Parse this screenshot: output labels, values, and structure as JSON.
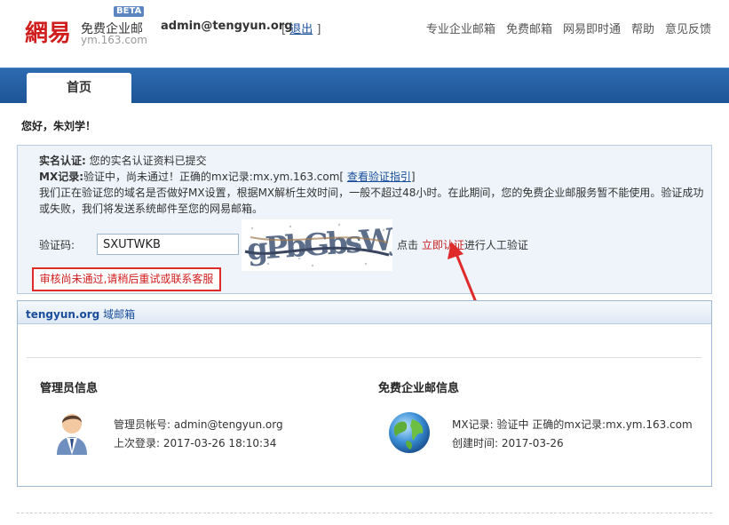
{
  "header": {
    "logo_mark": "網易",
    "logo_product": "免费企业邮",
    "logo_badge": "BETA",
    "logo_domain": "ym.163.com",
    "user_email": "admin@tengyun.org",
    "logout_label": "退出",
    "nav": [
      "专业企业邮箱",
      "免费邮箱",
      "网易即时通",
      "帮助",
      "意见反馈"
    ]
  },
  "tabs": {
    "home": "首页"
  },
  "greeting": "您好，朱刘学！",
  "verify": {
    "realname_label": "实名认证:",
    "realname_text": "您的实名认证资料已提交",
    "mx_label": "MX记录:",
    "mx_text": "验证中，尚未通过！正确的mx记录:mx.ym.163.com[",
    "mx_link": "查看验证指引",
    "mx_close": "]",
    "notice": "我们正在验证您的域名是否做好MX设置，根据MX解析生效时间，一般不超过48小时。在此期间，您的免费企业邮服务暂不能使用。验证成功或失败，我们将发送系统邮件至您的网易邮箱。",
    "captcha_label": "验证码:",
    "captcha_value": "SXUTWKB",
    "captcha_image_text": "gPbGbsWJ",
    "hint_prefix": "点击",
    "hint_link": "立即认证",
    "hint_suffix": "进行人工验证",
    "error": "审核尚未通过,请稍后重试或联系客服"
  },
  "domain_box": {
    "domain": "tengyun.org",
    "title_suffix": "域邮箱",
    "admin_title": "管理员信息",
    "admin_account_label": "管理员帐号:",
    "admin_account": "admin@tengyun.org",
    "last_login_label": "上次登录:",
    "last_login": "2017-03-26 18:10:34",
    "free_title": "免费企业邮信息",
    "mx_label": "MX记录:",
    "mx_status": "验证中 正确的mx记录:mx.ym.163.com",
    "created_label": "创建时间:",
    "created": "2017-03-26"
  },
  "colors": {
    "brand_red": "#d01e1e",
    "header_blue": "#1d5596",
    "link_blue": "#1a4e9c",
    "panel_bg": "#eef4fa"
  },
  "icons": [
    "netease-logo",
    "captcha-image",
    "annotation-arrow",
    "admin-user-icon",
    "globe-icon"
  ]
}
